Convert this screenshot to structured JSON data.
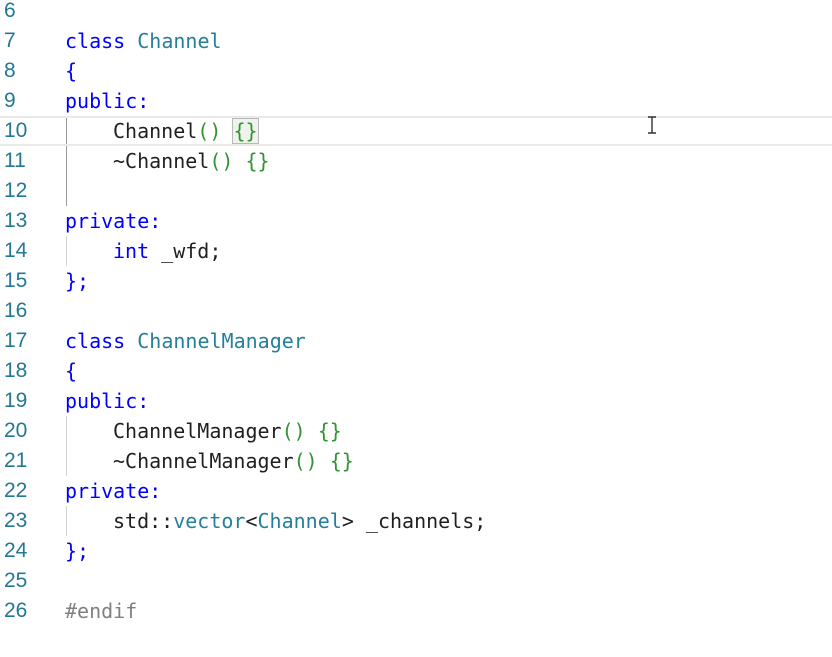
{
  "editor": {
    "lines": [
      {
        "number": "6"
      },
      {
        "number": "7",
        "kw": "class",
        "name": "Channel"
      },
      {
        "number": "8",
        "text": "{"
      },
      {
        "number": "9",
        "text": "public:"
      },
      {
        "number": "10",
        "name": "Channel",
        "parens": "()",
        "braces": "{}"
      },
      {
        "number": "11",
        "name": "~Channel",
        "parens": "()",
        "braces": "{}"
      },
      {
        "number": "12"
      },
      {
        "number": "13",
        "text": "private:"
      },
      {
        "number": "14",
        "kw": "int",
        "rest": "_wfd;"
      },
      {
        "number": "15",
        "text": "};"
      },
      {
        "number": "16"
      },
      {
        "number": "17",
        "kw": "class",
        "name": "ChannelManager"
      },
      {
        "number": "18",
        "text": "{"
      },
      {
        "number": "19",
        "text": "public:"
      },
      {
        "number": "20",
        "name": "ChannelManager",
        "parens": "()",
        "braces": "{}"
      },
      {
        "number": "21",
        "name": "~ChannelManager",
        "parens": "()",
        "braces": "{}"
      },
      {
        "number": "22",
        "text": "private:"
      },
      {
        "number": "23",
        "ns": "std::",
        "type": "vector",
        "lt": "<",
        "targ": "Channel",
        "gt": ">",
        "rest": "_channels;"
      },
      {
        "number": "24",
        "text": "};"
      },
      {
        "number": "25"
      },
      {
        "number": "26",
        "directive": "#endif"
      }
    ]
  },
  "colors": {
    "line_number": "#237893",
    "keyword": "#0000ff",
    "type": "#267f99",
    "brace": "#319331",
    "preprocessor": "#808080"
  },
  "icons": {
    "cursor": "text-cursor-icon"
  }
}
